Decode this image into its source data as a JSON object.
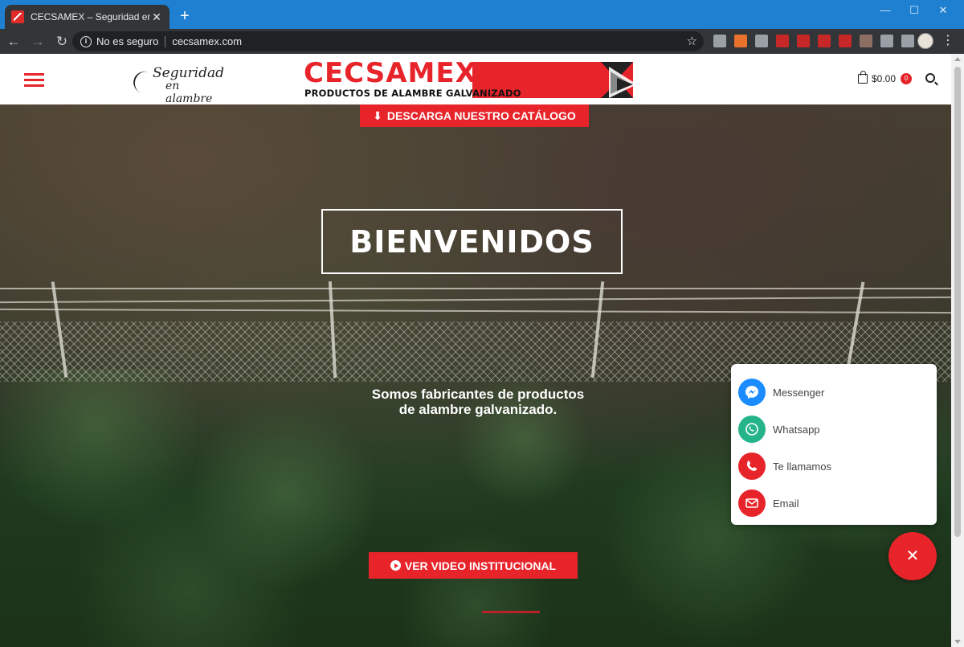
{
  "browser": {
    "tab_title": "CECSAMEX – Seguridad en alamb",
    "tab_close": "✕",
    "new_tab": "+",
    "security_label": "No es seguro",
    "url": "cecsamex.com",
    "window_controls": [
      "—",
      "☐",
      "✕"
    ],
    "extension_colors": [
      "#9aa0a6",
      "#e8712b",
      "#9aa0a6",
      "#c62828",
      "#c62828",
      "#c62828",
      "#c62828",
      "#8d6e63",
      "#9aa0a6",
      "#9aa0a6"
    ]
  },
  "header": {
    "tagline_line1": "Seguridad",
    "tagline_line2": "en alambre",
    "logo_brand": "CECSAMEX",
    "logo_sub": "PRODUCTOS DE ALAMBRE GALVANIZADO",
    "cart_total": "$0.00",
    "cart_count": "0"
  },
  "hero": {
    "download_label": "DESCARGA NUESTRO CATÁLOGO",
    "welcome": "BIENVENIDOS",
    "subtitle_line1": "Somos fabricantes de productos",
    "subtitle_line2": "de alambre galvanizado.",
    "video_label": "VER VIDEO INSTITUCIONAL"
  },
  "contact": {
    "items": [
      {
        "label": "Messenger",
        "color": "#1a8cff",
        "icon": "messenger-icon"
      },
      {
        "label": "Whatsapp",
        "color": "#25b38a",
        "icon": "whatsapp-icon"
      },
      {
        "label": "Te llamamos",
        "color": "#e8242b",
        "icon": "phone-icon"
      },
      {
        "label": "Email",
        "color": "#e8242b",
        "icon": "email-icon"
      }
    ],
    "close_symbol": "✕"
  },
  "colors": {
    "brand_red": "#e8242b",
    "chrome_blue": "#1f7fd1",
    "chrome_dark": "#323639"
  }
}
